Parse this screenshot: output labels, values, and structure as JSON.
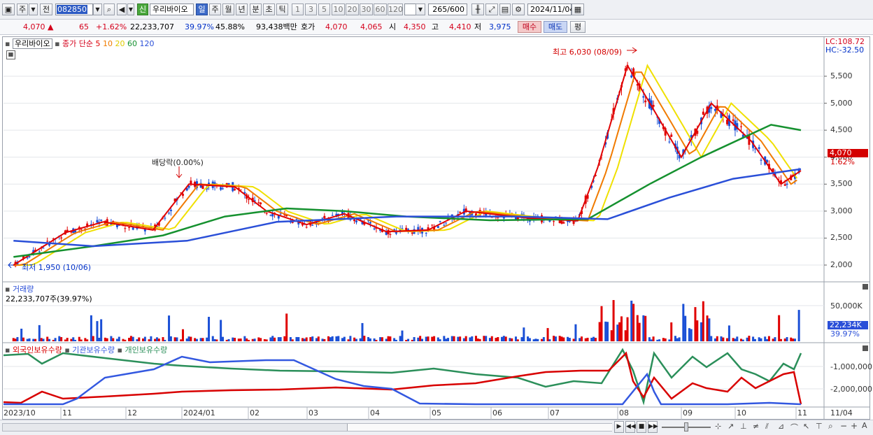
{
  "toolbar": {
    "market": "주",
    "prev": "전",
    "code": "082850",
    "new_badge": "신",
    "stock_name": "우리바이오",
    "periods": [
      "일",
      "주",
      "월",
      "년",
      "분",
      "초",
      "틱"
    ],
    "minute_units": [
      "1",
      "3",
      "5",
      "10",
      "20",
      "30",
      "60",
      "120"
    ],
    "count_value": "265",
    "count_max": "/600",
    "date": "2024/11/04"
  },
  "quote": {
    "price": "4,070 ▲",
    "change": "65",
    "change_pct": "+1.62%",
    "volume": "22,233,707",
    "turnover": "39.97%",
    "ratio": "45.88%",
    "amount": "93,438백만",
    "bid_label": "호가",
    "bid1": "4,070",
    "bid2": "4,065",
    "open_label": "시",
    "open": "4,350",
    "high_label": "고",
    "high": "4,410",
    "low_label": "저",
    "low": "3,975",
    "buy_label": "매수",
    "sell_label": "매도",
    "avg_label": "평"
  },
  "price_panel": {
    "stock_name": "우리바이오",
    "ma_label": "종가 단순",
    "ma_periods": [
      "5",
      "10",
      "20",
      "60",
      "120"
    ],
    "lc": "LC:108.72",
    "hc": "HC:-32.50",
    "high_annotation": "최고 6,030 (08/09)",
    "low_annotation": "최저 1,950 (10/06)",
    "dividend_annotation": "배당락(0.00%)",
    "current_price_tag": "4,070",
    "current_pct_tag": "1.62%",
    "y_ticks": [
      "5,500",
      "5,000",
      "4,500",
      "4,000",
      "3,500",
      "3,000",
      "2,500",
      "2,000"
    ]
  },
  "volume_panel": {
    "title": "거래량",
    "value_label": "22,233,707주(39.97%)",
    "y_tick": "50,000K",
    "current_tag": "22,234K",
    "current_pct": "39.97%"
  },
  "holding_panel": {
    "series": [
      "외국인보유수량",
      "기관보유수량",
      "개인보유수량"
    ],
    "y_ticks": [
      "-1,000,000",
      "-2,000,000"
    ]
  },
  "x_axis": [
    "2023/10",
    "11",
    "12",
    "2024/01",
    "02",
    "03",
    "04",
    "05",
    "06",
    "07",
    "08",
    "09",
    "10",
    "11",
    "11/04"
  ],
  "colors": {
    "ma5": "#e00000",
    "ma10": "#f07b00",
    "ma20": "#f0e000",
    "ma60": "#15912f",
    "ma120": "#2a4fd8",
    "up": "#e00000",
    "down": "#1a4fd6",
    "foreign": "#d80000",
    "institution": "#3358e0",
    "individual": "#2b8f5a"
  },
  "chart_data": {
    "type": "line",
    "title": "",
    "y_range": [
      1900,
      6100
    ],
    "x_range": [
      "2023/10",
      "2024/11/04"
    ],
    "series": [
      {
        "name": "5",
        "points": [
          [
            "2023-10-06",
            2000
          ],
          [
            "2023-11-01",
            2600
          ],
          [
            "2023-11-20",
            2800
          ],
          [
            "2023-12-15",
            2650
          ],
          [
            "2024-01-02",
            3500
          ],
          [
            "2024-01-25",
            3450
          ],
          [
            "2024-02-10",
            3000
          ],
          [
            "2024-03-01",
            2750
          ],
          [
            "2024-03-20",
            2950
          ],
          [
            "2024-04-10",
            2620
          ],
          [
            "2024-05-01",
            2650
          ],
          [
            "2024-05-20",
            3000
          ],
          [
            "2024-06-20",
            2870
          ],
          [
            "2024-07-15",
            2820
          ],
          [
            "2024-07-25",
            3800
          ],
          [
            "2024-08-09",
            5700
          ],
          [
            "2024-08-25",
            4700
          ],
          [
            "2024-09-05",
            4000
          ],
          [
            "2024-09-20",
            5000
          ],
          [
            "2024-10-10",
            4300
          ],
          [
            "2024-10-25",
            3500
          ],
          [
            "2024-11-04",
            3750
          ]
        ]
      },
      {
        "name": "60",
        "points": [
          [
            "2023-10-06",
            2150
          ],
          [
            "2023-11-15",
            2350
          ],
          [
            "2023-12-20",
            2550
          ],
          [
            "2024-01-20",
            2900
          ],
          [
            "2024-02-20",
            3050
          ],
          [
            "2024-03-20",
            3000
          ],
          [
            "2024-04-20",
            2900
          ],
          [
            "2024-06-01",
            2830
          ],
          [
            "2024-07-20",
            2850
          ],
          [
            "2024-08-20",
            3500
          ],
          [
            "2024-09-15",
            4000
          ],
          [
            "2024-10-20",
            4600
          ],
          [
            "2024-11-04",
            4500
          ]
        ]
      },
      {
        "name": "120",
        "points": [
          [
            "2023-10-06",
            2450
          ],
          [
            "2023-11-15",
            2350
          ],
          [
            "2024-01-01",
            2450
          ],
          [
            "2024-02-15",
            2800
          ],
          [
            "2024-04-15",
            2900
          ],
          [
            "2024-06-15",
            2900
          ],
          [
            "2024-07-30",
            2850
          ],
          [
            "2024-08-30",
            3250
          ],
          [
            "2024-10-01",
            3600
          ],
          [
            "2024-11-04",
            3780
          ]
        ]
      }
    ]
  }
}
